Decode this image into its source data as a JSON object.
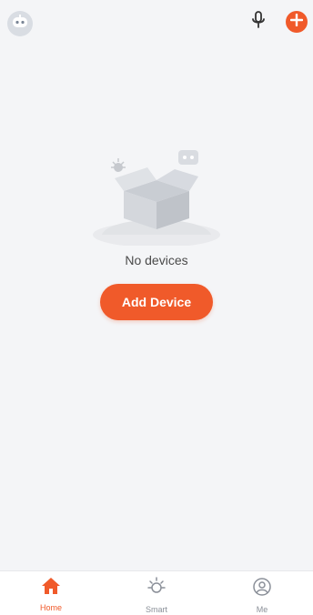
{
  "header": {
    "avatar_icon": "robot-face-icon",
    "mic_icon": "microphone-icon",
    "add_icon": "plus-icon"
  },
  "empty_state": {
    "message": "No devices",
    "button_label": "Add Device",
    "illustration": "open-box-illustration"
  },
  "tabs": [
    {
      "label": "Home",
      "icon": "home-icon",
      "active": true
    },
    {
      "label": "Smart",
      "icon": "sun-icon",
      "active": false
    },
    {
      "label": "Me",
      "icon": "user-circle-icon",
      "active": false
    }
  ],
  "colors": {
    "accent": "#f05a2a",
    "background": "#f4f5f7",
    "tab_inactive": "#8a8f98"
  }
}
